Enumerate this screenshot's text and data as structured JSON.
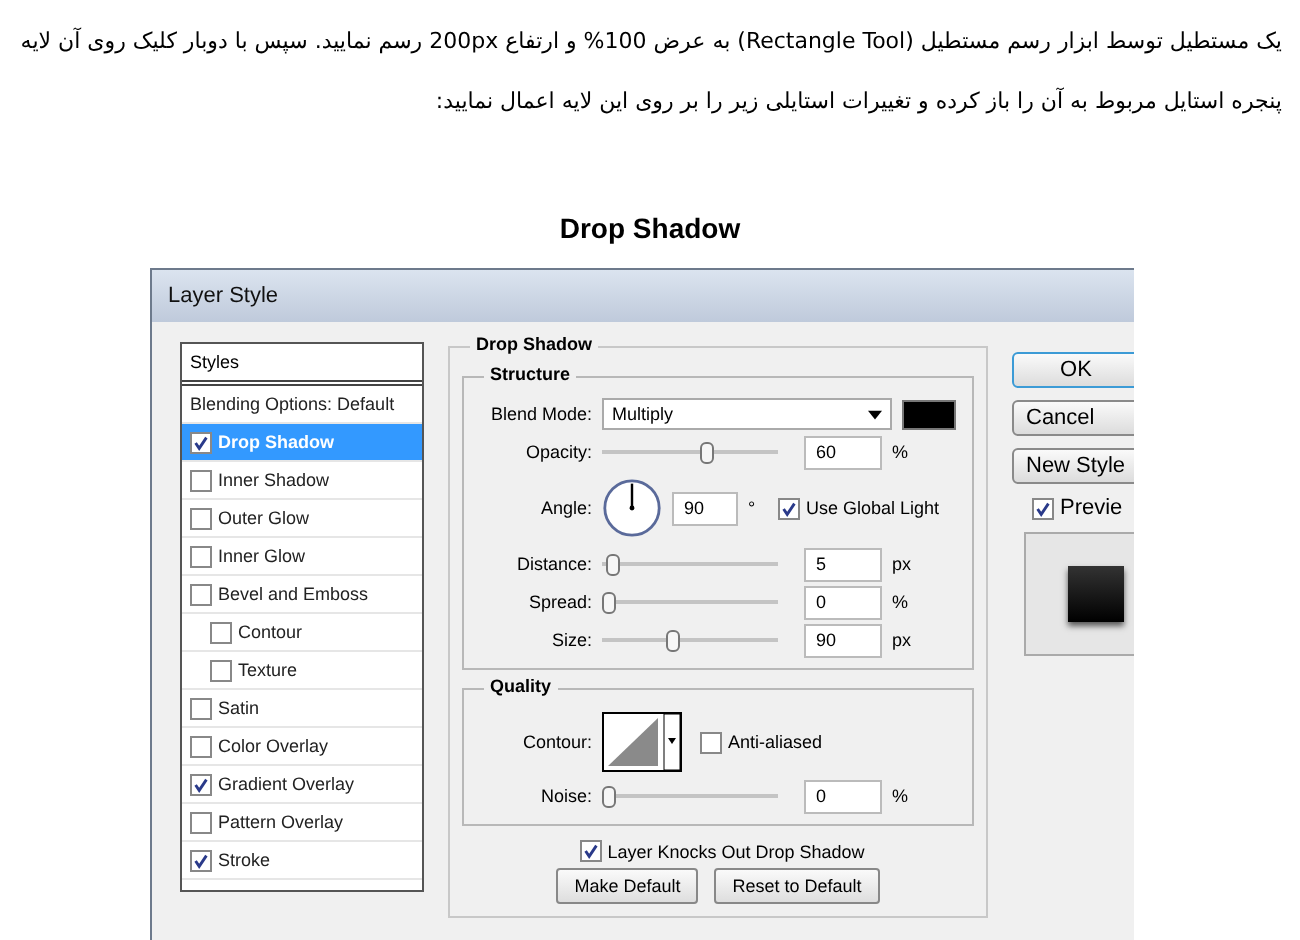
{
  "article": {
    "paragraph": "یک مستطیل توسط ابزار رسم مستطیل (Rectangle Tool) به عرض 100% و ارتفاع 200px رسم نمایید. سپس با دوبار کلیک روی آن لایه پنجره استایل مربوط به آن را باز کرده و تغییرات استایلی زیر را بر روی این لایه اعمال نمایید:",
    "heading": "Drop Shadow"
  },
  "dialog": {
    "title": "Layer Style",
    "styles_header": "Styles",
    "style_items": [
      {
        "label": "Blending Options: Default",
        "kind": "plain",
        "selected": false
      },
      {
        "label": "Drop Shadow",
        "kind": "check",
        "checked": true,
        "selected": true
      },
      {
        "label": "Inner Shadow",
        "kind": "check",
        "checked": false,
        "selected": false
      },
      {
        "label": "Outer Glow",
        "kind": "check",
        "checked": false,
        "selected": false
      },
      {
        "label": "Inner Glow",
        "kind": "check",
        "checked": false,
        "selected": false
      },
      {
        "label": "Bevel and Emboss",
        "kind": "check",
        "checked": false,
        "selected": false,
        "children": [
          {
            "label": "Contour",
            "kind": "check",
            "checked": false,
            "selected": false
          },
          {
            "label": "Texture",
            "kind": "check",
            "checked": false,
            "selected": false
          }
        ]
      },
      {
        "label": "Satin",
        "kind": "check",
        "checked": false,
        "selected": false
      },
      {
        "label": "Color Overlay",
        "kind": "check",
        "checked": false,
        "selected": false
      },
      {
        "label": "Gradient Overlay",
        "kind": "check",
        "checked": true,
        "selected": false
      },
      {
        "label": "Pattern Overlay",
        "kind": "check",
        "checked": false,
        "selected": false
      },
      {
        "label": "Stroke",
        "kind": "check",
        "checked": true,
        "selected": false
      }
    ],
    "section_title": "Drop Shadow",
    "structure": {
      "title": "Structure",
      "blend_mode": {
        "label": "Blend Mode:",
        "value": "Multiply"
      },
      "opacity": {
        "label": "Opacity:",
        "level": 0.6,
        "value": "60",
        "unit": "%"
      },
      "angle": {
        "label": "Angle:",
        "value": "90",
        "unit": "°"
      },
      "global_light": {
        "label": "Use Global Light",
        "checked": true
      },
      "sliders": [
        {
          "label": "Distance:",
          "level": 0.03,
          "value": "5",
          "unit": "px"
        },
        {
          "label": "Spread:",
          "level": 0,
          "value": "0",
          "unit": "%"
        },
        {
          "label": "Size:",
          "level": 0.4,
          "value": "90",
          "unit": "px"
        }
      ]
    },
    "quality": {
      "title": "Quality",
      "contour_label": "Contour:",
      "anti_aliased": {
        "label": "Anti-aliased",
        "checked": false
      },
      "noise": {
        "label": "Noise:",
        "level": 0,
        "value": "0",
        "unit": "%"
      }
    },
    "knockout": {
      "label": "Layer Knocks Out Drop Shadow",
      "checked": true
    },
    "buttons": [
      "Make Default",
      "Reset to Default"
    ],
    "side_buttons": [
      {
        "label": "OK",
        "default": true
      },
      {
        "label": "Cancel",
        "default": false
      },
      {
        "label": "New Style",
        "default": false
      }
    ],
    "preview": {
      "label": "Previe",
      "checked": true
    }
  }
}
